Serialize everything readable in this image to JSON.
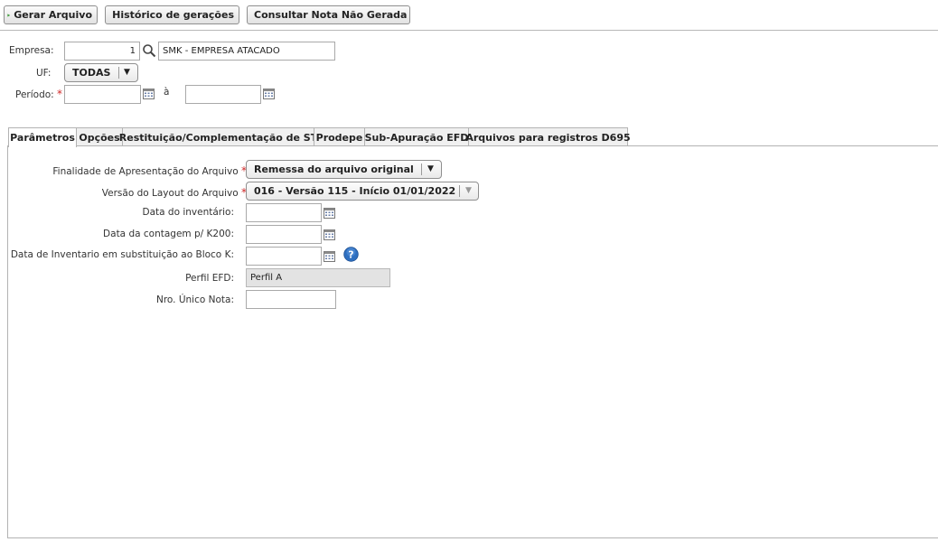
{
  "toolbar": {
    "generate_label": "Gerar Arquivo",
    "history_label": "Histórico de gerações",
    "consult_label": "Consultar Nota Não Gerada"
  },
  "header_form": {
    "empresa_label": "Empresa:",
    "empresa_code": "1",
    "empresa_name": "SMK - EMPRESA ATACADO",
    "uf_label": "UF:",
    "uf_value": "TODAS",
    "periodo_label": "Período:",
    "periodo_required": "*",
    "periodo_from": "",
    "periodo_sep": "à",
    "periodo_to": ""
  },
  "tabs": [
    {
      "label": "Parâmetros",
      "active": true
    },
    {
      "label": "Opções"
    },
    {
      "label": "Restituição/Complementação de ST"
    },
    {
      "label": "Prodepe"
    },
    {
      "label": "Sub-Apuração EFD"
    },
    {
      "label": "Arquivos para registros D695"
    }
  ],
  "params": {
    "finalidade_label": "Finalidade de Apresentação do Arquivo",
    "finalidade_value": "Remessa do arquivo original",
    "versao_label": "Versão do Layout do Arquivo",
    "versao_value": "016 - Versão 115 - Início 01/01/2022",
    "required_mark": "*",
    "inventario_label": "Data do inventário:",
    "inventario_value": "",
    "contagem_label": "Data da contagem p/ K200:",
    "contagem_value": "",
    "bloco_k_label": "Data de Inventario em substituição ao Bloco K:",
    "bloco_k_value": "",
    "perfil_label": "Perfil EFD:",
    "perfil_value": "Perfil A",
    "nro_label": "Nro. Único Nota:",
    "nro_value": ""
  },
  "icons": {
    "generate": "play-icon",
    "history": "history-icon",
    "consult": "magnifier-icon",
    "calendar": "calendar-icon",
    "help": "help-icon"
  },
  "colors": {
    "play_green": "#3aa335",
    "required_red": "#d02828",
    "help_blue": "#2e6fc0"
  }
}
